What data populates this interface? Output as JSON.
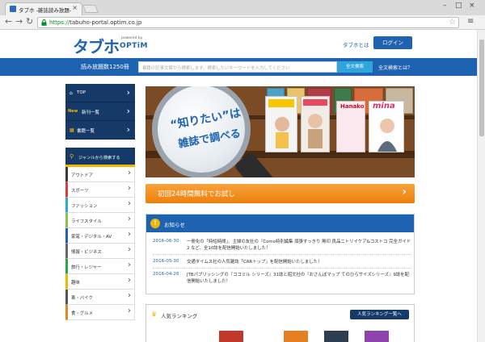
{
  "browser": {
    "tab_title": "タブホ -雑誌読み放題-",
    "url_scheme": "https://",
    "url_host": "tabuho-portal.optim.co.jp"
  },
  "header": {
    "logo": "タブホ",
    "logo_powered": "powered by",
    "logo_brand": "OPTiM",
    "about_link": "タブホとは",
    "login_label": "ログイン"
  },
  "search": {
    "count_label": "読み放題数1250冊",
    "placeholder": "書籍の記事文章から検索します。検索したいキーワードを入力してください",
    "button": "全文検索",
    "fulltext_link": "全文検索とは？"
  },
  "sidebar": {
    "nav": [
      {
        "icon": "house-icon",
        "label": "TOP"
      },
      {
        "icon": "new-badge",
        "badge": "New",
        "label": "新刊一覧"
      },
      {
        "icon": "book-icon",
        "label": "書籍一覧"
      }
    ],
    "genre_header": "ジャンルから検索する",
    "genres": [
      {
        "label": "アウトドア",
        "color": "#3a3a3a"
      },
      {
        "label": "スポーツ",
        "color": "#e03b3b"
      },
      {
        "label": "ファッション",
        "color": "#2aa8d8"
      },
      {
        "label": "ライフスタイル",
        "color": "#8bc34a"
      },
      {
        "label": "家電・デジタル・AV",
        "color": "#1e63b1"
      },
      {
        "label": "情報・ビジネス",
        "color": "#666666"
      },
      {
        "label": "旅行・レジャー",
        "color": "#28a745"
      },
      {
        "label": "趣味",
        "color": "#f7b500"
      },
      {
        "label": "車・バイク",
        "color": "#555555"
      },
      {
        "label": "食・グルメ",
        "color": "#e08a1e"
      }
    ]
  },
  "banner": {
    "line1": "“知りたい”は",
    "line2": "雑誌で調べる",
    "magazines": [
      "mina",
      "Hanako"
    ]
  },
  "cta": {
    "label": "初回24時間無料でお試し"
  },
  "news": {
    "title": "お知らせ",
    "items": [
      {
        "date": "2016-06-30",
        "text": "一冊化の「時短時間」、主婦の友社の『Como特別編集 頑張すっきり 無印 良品ニトリイケア&コストコ 完全ガイド2 など、全10誌を配信開始いたしました！"
      },
      {
        "date": "2016-05-30",
        "text": "交通タイムス社の人気雑誌「CARトップ」を配信開始いたしました！"
      },
      {
        "date": "2016-04-26",
        "text": "JTBパブリッシングの『ココミル シリーズ』31誌と昭文社の『おさんぽマップ てのひらサイズシリーズ』9誌を配信開始いたしました！"
      }
    ]
  },
  "ranking": {
    "title": "人気ランキング",
    "button": "人気ランキング一覧へ"
  },
  "colors": {
    "brand_blue": "#1e63b1",
    "navy": "#163a67",
    "orange": "#ee7f0b",
    "accent_yellow": "#f7b500"
  }
}
